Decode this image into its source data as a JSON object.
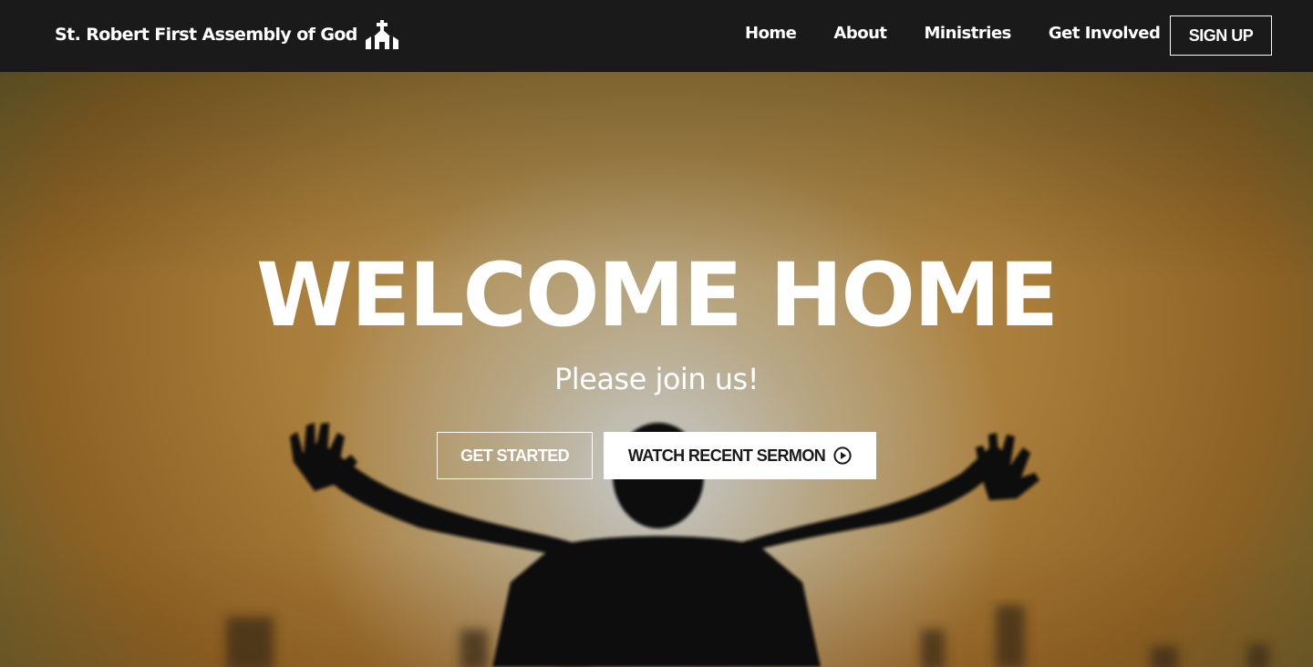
{
  "navbar": {
    "brand": "St. Robert First Assembly of God",
    "brand_icon": "church-icon",
    "links": [
      "Home",
      "About",
      "Ministries",
      "Get Involved"
    ],
    "signup_label": "SIGN UP"
  },
  "hero": {
    "title": "WELCOME HOME",
    "subtitle": "Please join us!",
    "primary_button": "GET STARTED",
    "secondary_button": "WATCH RECENT SERMON",
    "secondary_icon": "play-circle-icon"
  },
  "colors": {
    "navbar_bg": "#1b1a1b",
    "hero_gold": "#a97d3a",
    "text_light": "#ffffff",
    "text_dark": "#1b1a1b"
  }
}
